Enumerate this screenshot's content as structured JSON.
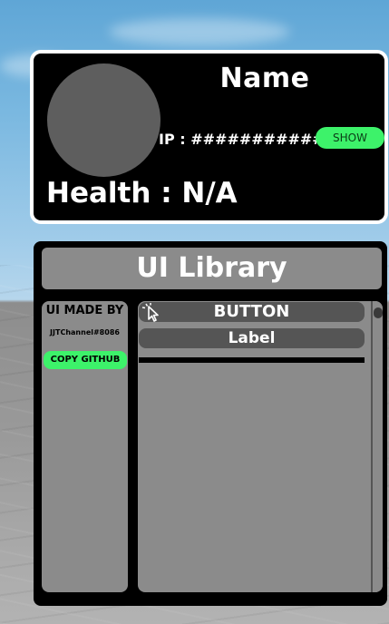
{
  "profile": {
    "name": "Name",
    "ip_text": "IP : #############",
    "show_label": "SHOW",
    "health_text": "Health : N/A"
  },
  "library": {
    "title": "UI Library",
    "side": {
      "made_by": "UI MADE BY",
      "discord": "JJTChannel#8086",
      "copy_label": "COPY GITHUB"
    },
    "main": {
      "button_label": "BUTTON",
      "label_text": "Label"
    }
  },
  "colors": {
    "accent": "#3df26a",
    "panel": "#8b8b8b",
    "row": "#555555",
    "background": "#000000"
  },
  "icons": {
    "button_icon": "cursor-click-icon"
  }
}
